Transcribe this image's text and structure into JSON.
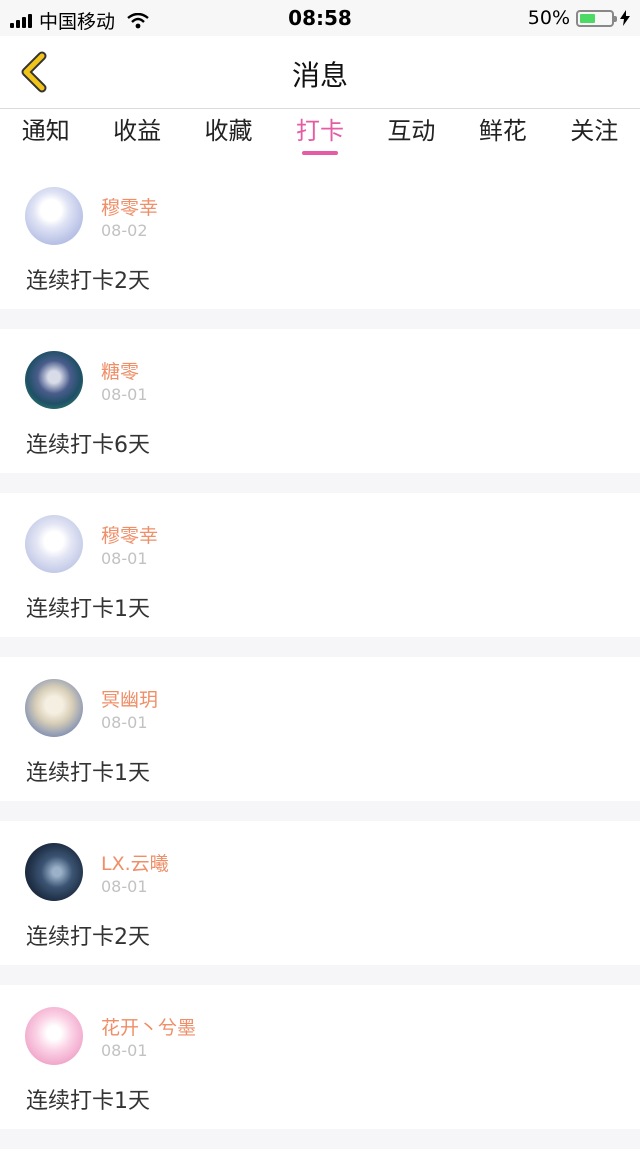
{
  "status_bar": {
    "carrier": "中国移动",
    "time": "08:58",
    "battery_percent": "50%",
    "battery_level": 0.5,
    "battery_color": "#4cd964"
  },
  "header": {
    "title": "消息",
    "back_icon": "chevron-left-icon",
    "back_color": "#f0c419"
  },
  "tabs": [
    {
      "label": "通知",
      "active": false
    },
    {
      "label": "收益",
      "active": false
    },
    {
      "label": "收藏",
      "active": false
    },
    {
      "label": "打卡",
      "active": true
    },
    {
      "label": "互动",
      "active": false
    },
    {
      "label": "鲜花",
      "active": false
    },
    {
      "label": "关注",
      "active": false
    }
  ],
  "accent_color": "#e55ca4",
  "name_color": "#ef8e67",
  "messages": [
    {
      "name": "穆零幸",
      "date": "08-02",
      "text": "连续打卡2天"
    },
    {
      "name": "糖零",
      "date": "08-01",
      "text": "连续打卡6天"
    },
    {
      "name": "穆零幸",
      "date": "08-01",
      "text": "连续打卡1天"
    },
    {
      "name": "冥幽玥",
      "date": "08-01",
      "text": "连续打卡1天"
    },
    {
      "name": "LX.云曦",
      "date": "08-01",
      "text": "连续打卡2天"
    },
    {
      "name": "花开丶兮墨",
      "date": "08-01",
      "text": "连续打卡1天"
    }
  ]
}
